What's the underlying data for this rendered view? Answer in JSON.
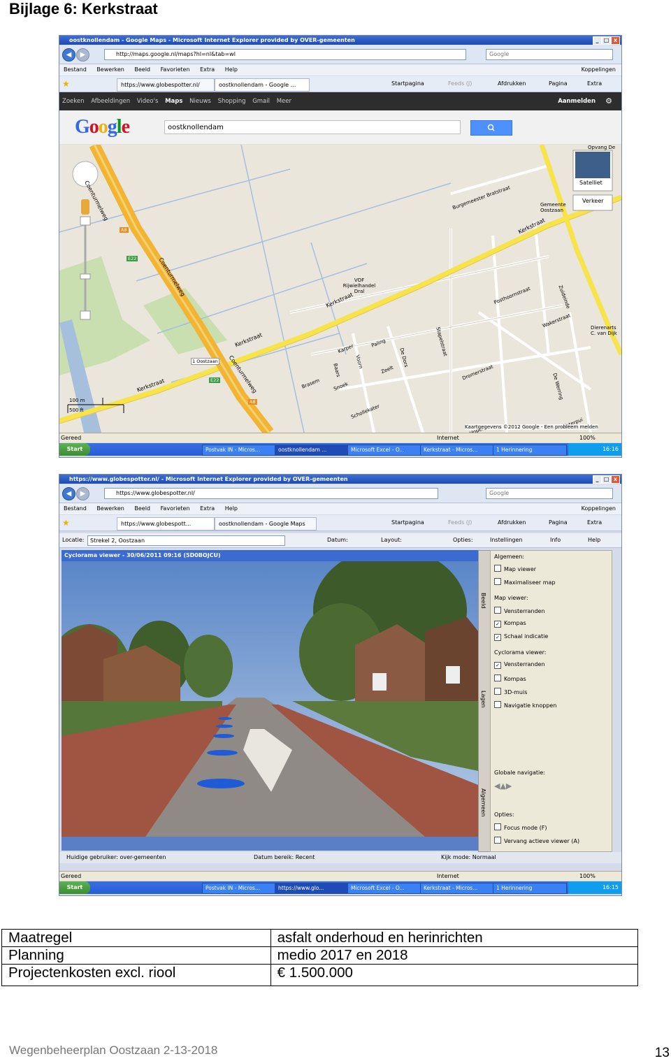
{
  "heading": "Bijlage 6: Kerkstraat",
  "shot1": {
    "window_title": "oostknollendam - Google Maps - Microsoft Internet Explorer provided by OVER-gemeenten",
    "address": "http://maps.google.nl/maps?hl=nl&tab=wl",
    "search_placeholder": "Google",
    "menu": [
      "Bestand",
      "Bewerken",
      "Beeld",
      "Favorieten",
      "Extra",
      "Help"
    ],
    "menu_right": "Koppelingen",
    "tabs": [
      "https://www.globespotter.nl/",
      "oostknollendam - Google ..."
    ],
    "toolbar_right": [
      "Startpagina",
      "Feeds (J)",
      "Afdrukken",
      "Pagina",
      "Extra"
    ],
    "gbar": [
      "Zoeken",
      "Afbeeldingen",
      "Video's",
      "Maps",
      "Nieuws",
      "Shopping",
      "Gmail",
      "Meer"
    ],
    "gbar_signin": "Aanmelden",
    "logo": "Google",
    "search_value": "oostknollendam",
    "map_labels": {
      "coenturm1": "Coenturmelweg",
      "coenturm2": "Coenturmelweg",
      "coenturm3": "Coenturmelweg",
      "kerk1": "Kerkstraat",
      "kerk2": "Kerkstraat",
      "kerk3": "Kerkstraat",
      "kerk4": "Kerkstraat",
      "burgemeester": "Burgemeester Bratstraat",
      "gemeente": "Gemeente Oostzaan",
      "vof": "VOF Rijwielhandel Dral",
      "zuideinde": "Zuideinde",
      "wakerstraat": "Wakerstraat",
      "posthoorn": "Posthoornstraat",
      "dromerstraat": "Dromerstraat",
      "stapelstraat": "Stapelstraat",
      "karper": "Karper",
      "paling": "Paling",
      "baars": "Baars",
      "voorn": "Voorn",
      "zeelt": "Zeelt",
      "brasem": "Brasem",
      "snoek": "Snoek",
      "dedors": "De Dors",
      "schollekater": "Schollekater",
      "dierenarts": "Dierenarts C. van Dijk",
      "dehoper": "De Hoper",
      "waterpui": "Waterpui",
      "dewerring": "De Werring",
      "costzaan": "1 Oostzaan",
      "a8_1": "A8",
      "a8_2": "A8",
      "e22_1": "E22",
      "e22_2": "E22",
      "satelliet": "Satelliet",
      "verkeer": "Verkeer",
      "scale_m": "100 m",
      "scale_ft": "500 ft",
      "copyright": "Kaartgegevens ©2012 Google - Een probleem melden",
      "opvang": "Opvang De"
    },
    "status_left": "Gereed",
    "status_zone": "Internet",
    "zoom": "100%",
    "tasks": [
      "Postvak IN - Micros...",
      "oostknollendam ...",
      "Microsoft Excel - O...",
      "Kerkstraat - Micros...",
      "1 Herinnering"
    ],
    "start": "Start",
    "clock": "16:16"
  },
  "shot2": {
    "window_title": "https://www.globespotter.nl/ - Microsoft Internet Explorer provided by OVER-gemeenten",
    "address": "https://www.globespotter.nl/",
    "search_placeholder": "Google",
    "menu": [
      "Bestand",
      "Bewerken",
      "Beeld",
      "Favorieten",
      "Extra",
      "Help"
    ],
    "menu_right": "Koppelingen",
    "tabs": [
      "https://www.globespott...",
      "oostknollendam - Google Maps"
    ],
    "toolbar_right": [
      "Startpagina",
      "Feeds (J)",
      "Afdrukken",
      "Pagina",
      "Extra"
    ],
    "locatie_label": "Locatie:",
    "locatie_value": "Strekel 2, Oostzaan",
    "datum_label": "Datum:",
    "layout_label": "Layout:",
    "opties_label": "Opties:",
    "instellingen": "Instellingen",
    "info": "Info",
    "help": "Help",
    "viewer_title": "Cyclorama viewer - 30/06/2011 09:16 (5D0BOJCU)",
    "side_tabs": [
      "Beeld",
      "Lagen",
      "Algemeen"
    ],
    "side": {
      "algemeen": "Algemeen:",
      "map_viewer_opt": "Map viewer",
      "maximaliseer": "Maximaliseer map",
      "map_viewer_hdr": "Map viewer:",
      "vensterranden1": "Vensterranden",
      "kompas1": "Kompas",
      "schaal": "Schaal indicatie",
      "cyc_hdr": "Cyclorama viewer:",
      "vensterranden2": "Vensterranden",
      "kompas2": "Kompas",
      "muis": "3D-muis",
      "navknoppen": "Navigatie knoppen",
      "globale": "Globale navigatie:",
      "opties": "Opties:",
      "focus": "Focus mode (F)",
      "vervang": "Vervang actieve viewer (A)"
    },
    "info_user": "Huidige gebruiker:  over-gemeenten",
    "info_datum": "Datum bereik:  Recent",
    "info_kijk": "Kijk mode:  Normaal",
    "status_left": "Gereed",
    "status_zone": "Internet",
    "zoom": "100%",
    "tasks": [
      "Postvak IN - Micros...",
      "https://www.glo...",
      "Microsoft Excel - O...",
      "Kerkstraat - Micros...",
      "1 Herinnering"
    ],
    "start": "Start",
    "clock": "16:15"
  },
  "table": [
    [
      "Maatregel",
      "asfalt onderhoud en herinrichten"
    ],
    [
      "Planning",
      "medio 2017 en 2018"
    ],
    [
      "Projectenkosten excl. riool",
      "€ 1.500.000"
    ]
  ],
  "footer": "Wegenbeheerplan Oostzaan 2-13-2018",
  "page_number": "13"
}
